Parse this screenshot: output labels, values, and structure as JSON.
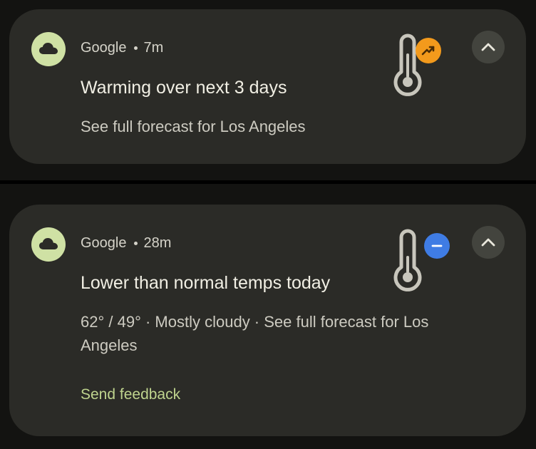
{
  "notifications": [
    {
      "app_name": "Google",
      "time": "7m",
      "title": "Warming over next 3 days",
      "body": "See full forecast for Los Angeles",
      "app_icon": "cloud-icon",
      "image_icon": "thermometer-icon",
      "badge_icon": "trending-up-icon",
      "badge_color": "#f39a1c",
      "expand_icon": "chevron-up-icon"
    },
    {
      "app_name": "Google",
      "time": "28m",
      "title": "Lower than normal temps today",
      "body": "62° / 49° · Mostly cloudy · See full forecast for Los Angeles",
      "app_icon": "cloud-icon",
      "image_icon": "thermometer-icon",
      "badge_icon": "minus-icon",
      "badge_color": "#3f7ce4",
      "expand_icon": "chevron-up-icon",
      "action_label": "Send feedback"
    }
  ],
  "colors": {
    "background": "#131311",
    "card": "#2b2b27",
    "app_icon_bg": "#cfe1a4",
    "action_text": "#bfd48e"
  }
}
